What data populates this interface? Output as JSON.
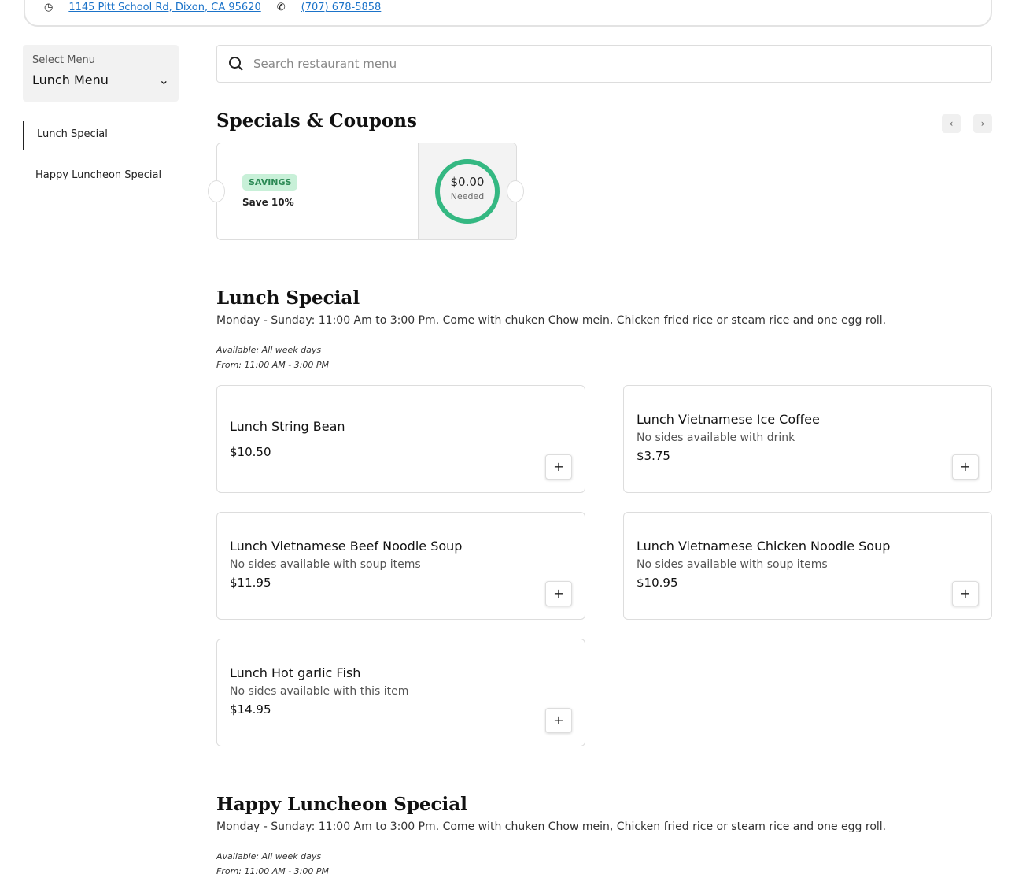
{
  "header": {
    "address": "1145 Pitt School Rd, Dixon, CA 95620",
    "phone": "(707) 678-5858"
  },
  "menu_select": {
    "label": "Select Menu",
    "value": "Lunch Menu"
  },
  "sidebar": {
    "items": [
      {
        "label": "Lunch Special"
      },
      {
        "label": "Happy Luncheon Special"
      }
    ]
  },
  "search": {
    "placeholder": "Search restaurant menu"
  },
  "specials": {
    "title": "Specials & Coupons",
    "coupon": {
      "badge": "SAVINGS",
      "text": "Save 10%",
      "amount": "$0.00",
      "amount_label": "Needed"
    }
  },
  "sections": [
    {
      "title": "Lunch Special",
      "desc": "Monday - Sunday: 11:00 Am to 3:00 Pm. Come with chuken Chow mein, Chicken fried rice or steam rice and one egg roll.",
      "available": "Available: All week days",
      "from": "From: 11:00 AM - 3:00 PM",
      "items": [
        {
          "name": "Lunch String Bean",
          "desc": "",
          "price": "$10.50"
        },
        {
          "name": "Lunch Vietnamese Ice Coffee",
          "desc": "No sides available with drink",
          "price": "$3.75"
        },
        {
          "name": "Lunch Vietnamese Beef Noodle Soup",
          "desc": "No sides available with soup items",
          "price": "$11.95"
        },
        {
          "name": "Lunch Vietnamese Chicken Noodle Soup",
          "desc": "No sides available with soup items",
          "price": "$10.95"
        },
        {
          "name": "Lunch Hot garlic Fish",
          "desc": "No sides available with this item",
          "price": "$14.95"
        }
      ]
    },
    {
      "title": "Happy Luncheon Special",
      "desc": "Monday - Sunday: 11:00 Am to 3:00 Pm. Come with chuken Chow mein, Chicken fried rice or steam rice and one egg roll.",
      "available": "Available: All week days",
      "from": "From: 11:00 AM - 3:00 PM"
    }
  ]
}
